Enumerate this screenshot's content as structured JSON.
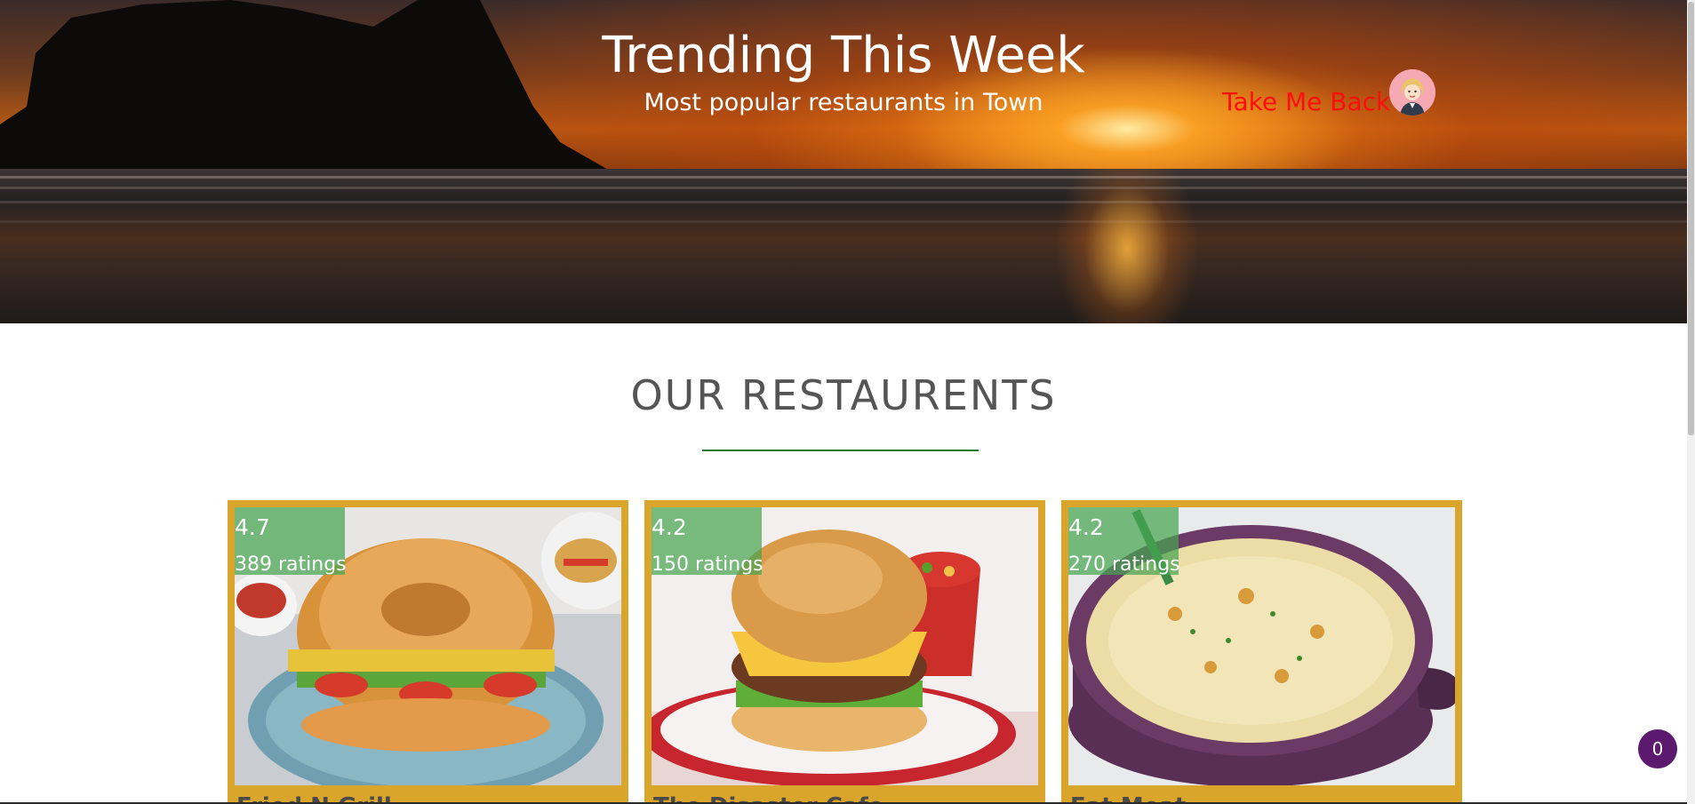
{
  "hero": {
    "title": "Trending This Week",
    "subtitle": "Most popular restaurants in Town",
    "back_link_label": "Take Me Back",
    "back_link_color": "#ff0d0d"
  },
  "section": {
    "title": "OUR RESTAURENTS",
    "divider_color": "#1f7a2c"
  },
  "restaurants": [
    {
      "name": "Fried N Grill",
      "rating": "4.7",
      "ratings_count": "389 ratings",
      "image": "stuffed-sandwich-ring-photo"
    },
    {
      "name": "The Disaster Cafe",
      "rating": "4.2",
      "ratings_count": "150 ratings",
      "image": "cheeseburger-photo"
    },
    {
      "name": "Eat Meat",
      "rating": "4.2",
      "ratings_count": "270 ratings",
      "image": "pasta-bake-pot-photo"
    }
  ],
  "cart": {
    "count": "0",
    "color": "#5c1a6f"
  },
  "colors": {
    "card_border": "#d9a62b",
    "rating_overlay": "#46a550"
  }
}
